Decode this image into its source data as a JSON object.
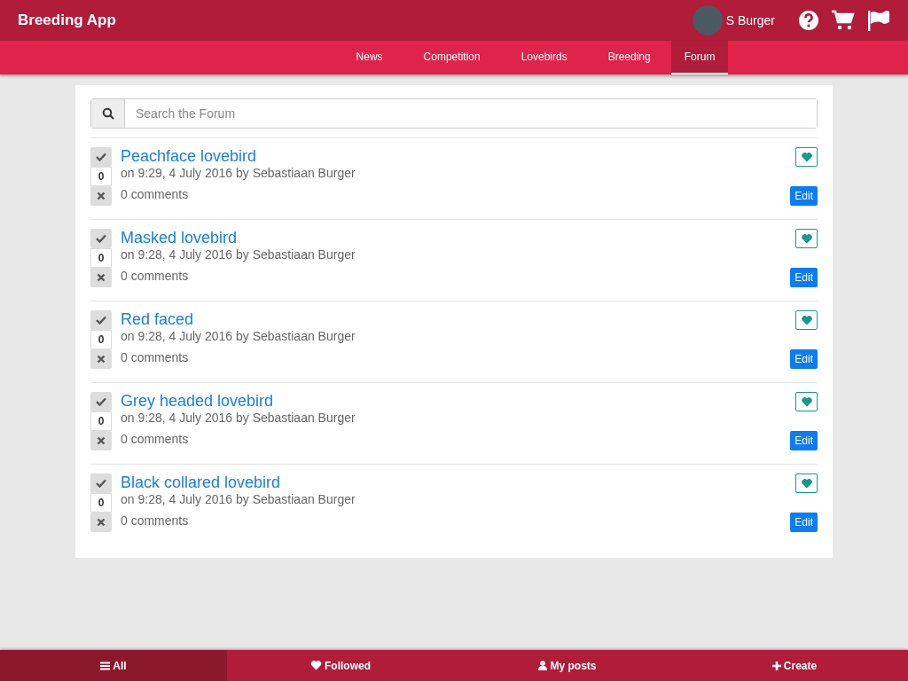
{
  "header": {
    "title": "Breeding App",
    "user": "S Burger"
  },
  "nav": [
    {
      "label": "News",
      "selected": false
    },
    {
      "label": "Competition",
      "selected": false
    },
    {
      "label": "Lovebirds",
      "selected": false
    },
    {
      "label": "Breeding",
      "selected": false
    },
    {
      "label": "Forum",
      "selected": true
    }
  ],
  "search": {
    "placeholder": "Search the Forum"
  },
  "posts": [
    {
      "title": "Peachface lovebird",
      "meta": "on 9:29, 4 July 2016 by Sebastiaan Burger",
      "votes": "0",
      "comments": "0 comments",
      "edit": "Edit"
    },
    {
      "title": "Masked lovebird",
      "meta": "on 9:28, 4 July 2016 by Sebastiaan Burger",
      "votes": "0",
      "comments": "0 comments",
      "edit": "Edit"
    },
    {
      "title": "Red faced",
      "meta": "on 9:28, 4 July 2016 by Sebastiaan Burger",
      "votes": "0",
      "comments": "0 comments",
      "edit": "Edit"
    },
    {
      "title": "Grey headed lovebird",
      "meta": "on 9:28, 4 July 2016 by Sebastiaan Burger",
      "votes": "0",
      "comments": "0 comments",
      "edit": "Edit"
    },
    {
      "title": "Black collared lovebird",
      "meta": "on 9:28, 4 July 2016 by Sebastiaan Burger",
      "votes": "0",
      "comments": "0 comments",
      "edit": "Edit"
    }
  ],
  "bottom_tabs": [
    {
      "kind": "list",
      "label": "All",
      "selected": true
    },
    {
      "kind": "heart",
      "label": "Followed",
      "selected": false
    },
    {
      "kind": "user",
      "label": "My posts",
      "selected": false
    },
    {
      "kind": "plus",
      "label": "Create",
      "selected": false
    }
  ]
}
